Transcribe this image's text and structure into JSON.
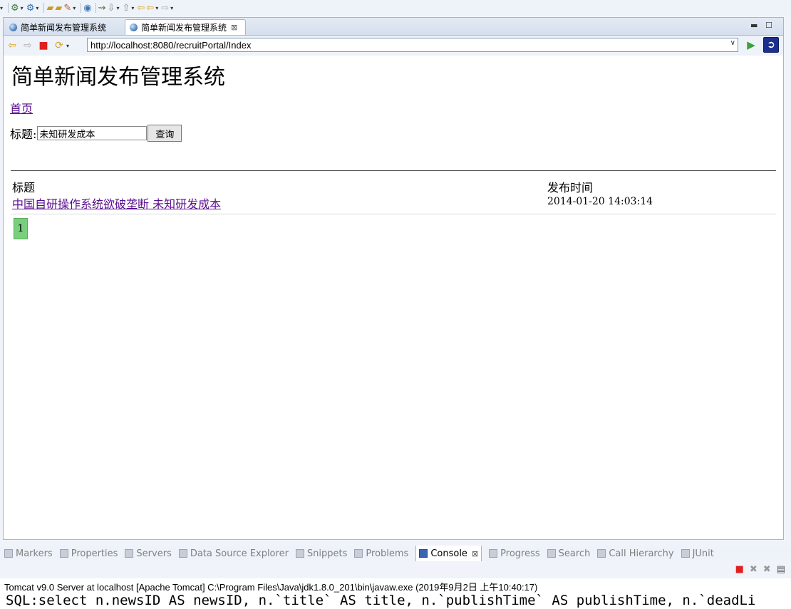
{
  "toolbar": {
    "icons": [
      "run-icon",
      "debug-icon",
      "open-folder-icon",
      "build-icon",
      "globe-icon",
      "search-icon",
      "back-icon",
      "forward-icon"
    ]
  },
  "browser": {
    "tabs": [
      {
        "label": "简单新闻发布管理系统",
        "active": false
      },
      {
        "label": "简单新闻发布管理系统",
        "active": true
      }
    ],
    "close_glyph": "⊠",
    "url": "http://localhost:8080/recruitPortal/Index"
  },
  "page": {
    "title": "简单新闻发布管理系统",
    "home_link": "首页",
    "search_label": "标题:",
    "search_value": "未知研发成本",
    "search_button": "查询",
    "table": {
      "headers": [
        "标题",
        "发布时间"
      ],
      "rows": [
        {
          "title": "中国自研操作系统欲破垄断 未知研发成本",
          "time": "2014-01-20 14:03:14"
        }
      ]
    },
    "pagination": [
      "1"
    ],
    "colors": {
      "link": "#5b0f8f",
      "pager_active": "#79cf7c"
    }
  },
  "bottom_panel": {
    "tabs": [
      {
        "label": "Markers",
        "icon": "markers-icon"
      },
      {
        "label": "Properties",
        "icon": "properties-icon"
      },
      {
        "label": "Servers",
        "icon": "servers-icon"
      },
      {
        "label": "Data Source Explorer",
        "icon": "database-icon"
      },
      {
        "label": "Snippets",
        "icon": "snippets-icon"
      },
      {
        "label": "Problems",
        "icon": "problems-icon"
      },
      {
        "label": "Console",
        "icon": "console-icon",
        "active": true
      },
      {
        "label": "Progress",
        "icon": "progress-icon"
      },
      {
        "label": "Search",
        "icon": "search-icon"
      },
      {
        "label": "Call Hierarchy",
        "icon": "hierarchy-icon"
      },
      {
        "label": "JUnit",
        "icon": "junit-icon"
      }
    ],
    "console_header": "Tomcat v9.0 Server at localhost [Apache Tomcat] C:\\Program Files\\Java\\jdk1.8.0_201\\bin\\javaw.exe (2019年9月2日 上午10:40:17)",
    "console_line": "SQL:select n.newsID AS newsID, n.`title` AS title, n.`publishTime` AS publishTime, n.`deadLi"
  }
}
